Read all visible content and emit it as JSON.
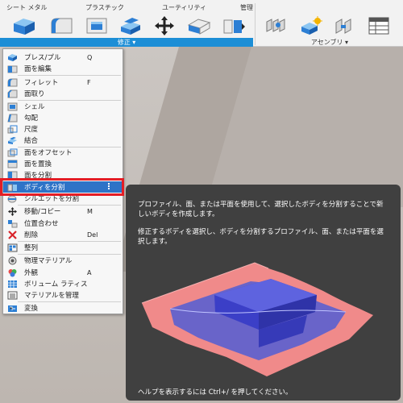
{
  "tabs": [
    "シート メタル",
    "プラスチック",
    "ユーティリティ",
    "管理"
  ],
  "ribbon": {
    "modify_label": "修正 ▾",
    "assembly_label": "アセンブリ ▾"
  },
  "menu": {
    "items": [
      {
        "label": "プレス/プル",
        "shortcut": "Q",
        "icon": "press-pull-icon"
      },
      {
        "label": "面を編集",
        "shortcut": "",
        "icon": "edit-face-icon"
      },
      {
        "label": "フィレット",
        "shortcut": "F",
        "icon": "fillet-icon"
      },
      {
        "label": "面取り",
        "shortcut": "",
        "icon": "chamfer-icon"
      },
      {
        "label": "シェル",
        "shortcut": "",
        "icon": "shell-icon"
      },
      {
        "label": "勾配",
        "shortcut": "",
        "icon": "draft-icon"
      },
      {
        "label": "尺度",
        "shortcut": "",
        "icon": "scale-icon"
      },
      {
        "label": "結合",
        "shortcut": "",
        "icon": "combine-icon"
      },
      {
        "label": "面をオフセット",
        "shortcut": "",
        "icon": "offset-face-icon"
      },
      {
        "label": "面を置換",
        "shortcut": "",
        "icon": "replace-face-icon"
      },
      {
        "label": "面を分割",
        "shortcut": "",
        "icon": "split-face-icon"
      },
      {
        "label": "ボディを分割",
        "shortcut": "",
        "icon": "split-body-icon"
      },
      {
        "label": "シルエットを分割",
        "shortcut": "",
        "icon": "silhouette-split-icon"
      },
      {
        "label": "移動/コピー",
        "shortcut": "M",
        "icon": "move-icon"
      },
      {
        "label": "位置合わせ",
        "shortcut": "",
        "icon": "align-icon"
      },
      {
        "label": "削除",
        "shortcut": "Del",
        "icon": "delete-icon"
      },
      {
        "label": "整列",
        "shortcut": "",
        "icon": "arrange-icon"
      },
      {
        "label": "物理マテリアル",
        "shortcut": "",
        "icon": "physical-material-icon"
      },
      {
        "label": "外観",
        "shortcut": "A",
        "icon": "appearance-icon"
      },
      {
        "label": "ボリューム ラティス",
        "shortcut": "",
        "icon": "volumetric-lattice-icon"
      },
      {
        "label": "マテリアルを管理",
        "shortcut": "",
        "icon": "manage-materials-icon"
      },
      {
        "label": "変換",
        "shortcut": "",
        "icon": "convert-icon"
      }
    ]
  },
  "tooltip": {
    "p1": "プロファイル、面、または平面を使用して、選択したボディを分割することで新しいボディを作成します。",
    "p2": "修正するボディを選択し、ボディを分割するプロファイル、面、または平面を選択します。",
    "footer": "ヘルプを表示するには Ctrl+/ を押してください。"
  },
  "colors": {
    "accent": "#1c8ed6",
    "highlight": "#2e73c7",
    "selection_frame": "#e41d25",
    "tooltip_bg": "#404040"
  }
}
